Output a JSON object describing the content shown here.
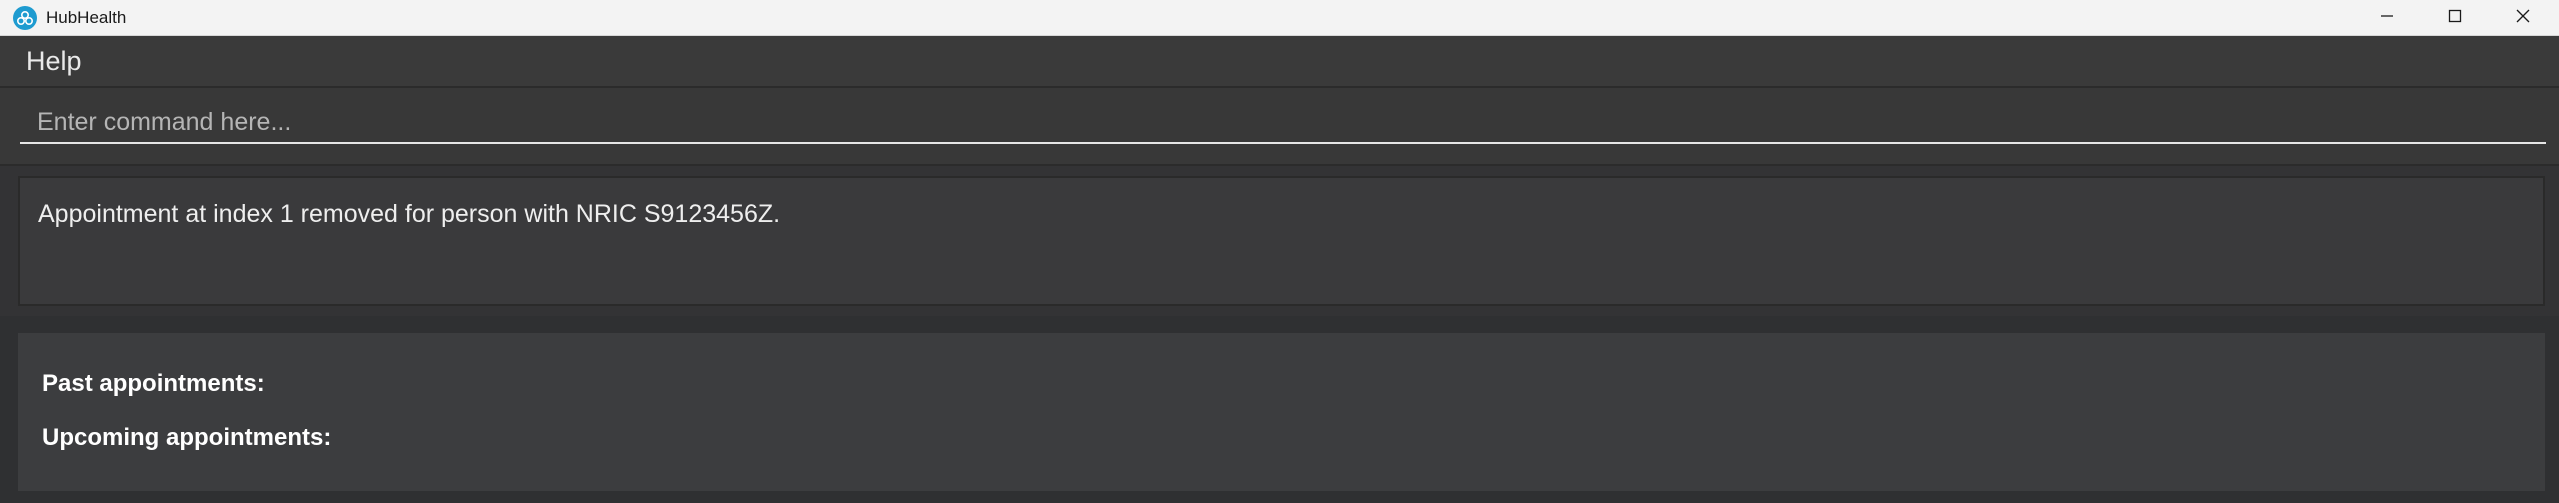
{
  "window": {
    "title": "HubHealth",
    "icon": "hubhealth-logo-icon",
    "controls": [
      "minimize-icon",
      "maximize-icon",
      "close-icon"
    ]
  },
  "menubar": {
    "help_label": "Help"
  },
  "command_box": {
    "placeholder": "Enter command here...",
    "value": ""
  },
  "result_display": {
    "text": "Appointment at index 1 removed for person with NRIC S9123456Z."
  },
  "appointments": {
    "past_label": "Past appointments:",
    "upcoming_label": "Upcoming appointments:"
  },
  "colors": {
    "accent": "#1e9bd0",
    "background": "#2f3032"
  }
}
